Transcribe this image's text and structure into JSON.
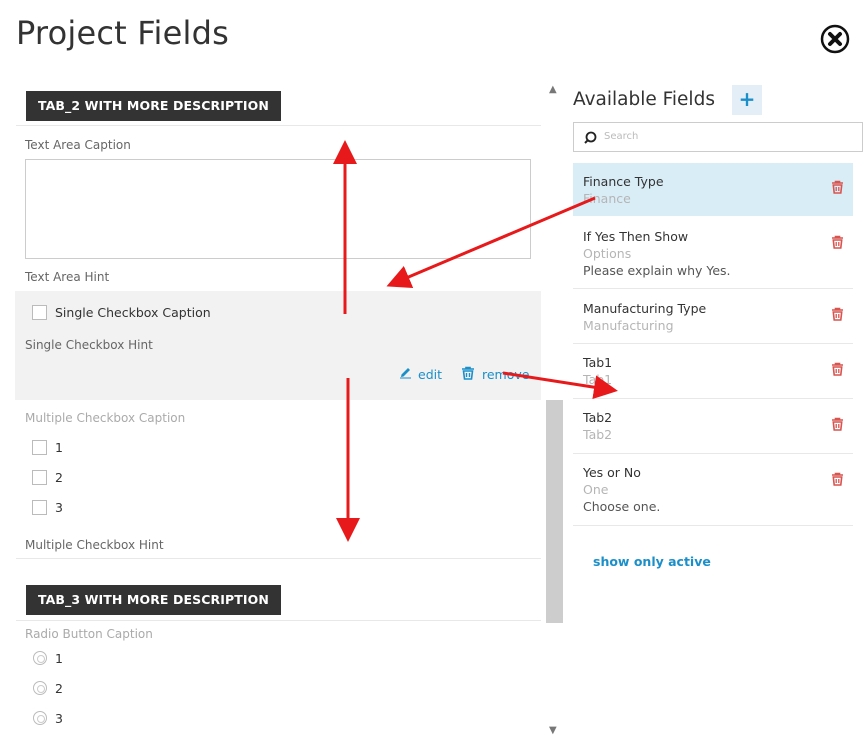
{
  "title": "Project Fields",
  "left": {
    "tab2": "TAB_2 WITH MORE DESCRIPTION",
    "text_area_caption": "Text Area Caption",
    "text_area_hint": "Text Area Hint",
    "single_checkbox_caption": "Single Checkbox Caption",
    "single_checkbox_hint": "Single Checkbox Hint",
    "edit": "edit",
    "remove": "remove",
    "multi_caption": "Multiple Checkbox Caption",
    "multi_options": [
      "1",
      "2",
      "3"
    ],
    "multi_hint": "Multiple Checkbox Hint",
    "tab3": "TAB_3 WITH MORE DESCRIPTION",
    "radio_caption": "Radio Button Caption",
    "radio_options": [
      "1",
      "2",
      "3"
    ]
  },
  "right": {
    "title": "Available Fields",
    "add": "+",
    "search_placeholder": "Search",
    "fields": [
      {
        "name": "Finance Type",
        "type": "Finance",
        "hint": ""
      },
      {
        "name": "If Yes Then Show",
        "type": "Options",
        "hint": "Please explain why Yes."
      },
      {
        "name": "Manufacturing Type",
        "type": "Manufacturing",
        "hint": ""
      },
      {
        "name": "Tab1",
        "type": "Tab1",
        "hint": ""
      },
      {
        "name": "Tab2",
        "type": "Tab2",
        "hint": ""
      },
      {
        "name": "Yes or No",
        "type": "One",
        "hint": "Choose one."
      }
    ],
    "show_only_active": "show only active"
  },
  "colors": {
    "accent": "#1a8fc9",
    "danger": "#d9534f",
    "arrow": "#e8191a",
    "selected_row": "#d9edf7",
    "tab_header": "#333333"
  }
}
